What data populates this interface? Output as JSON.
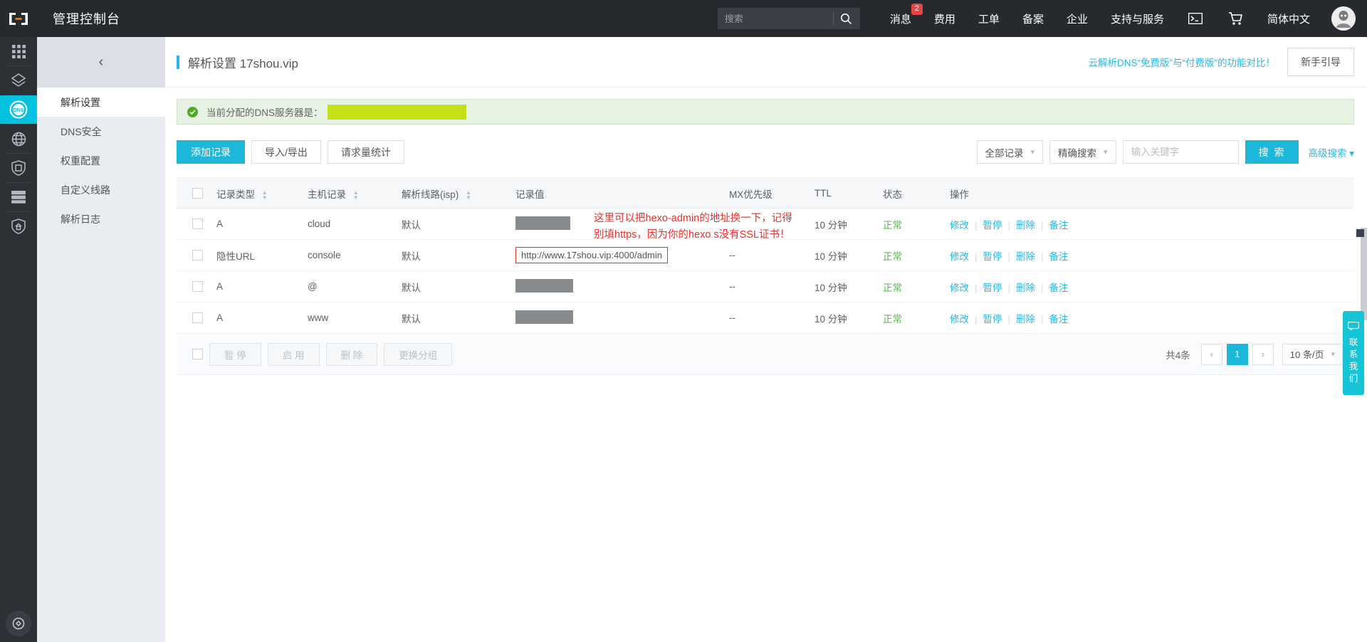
{
  "topbar": {
    "logo_name": "aliyun-logo",
    "console_title": "管理控制台",
    "search_placeholder": "搜索",
    "nav": [
      {
        "label": "消息",
        "badge": "2"
      },
      {
        "label": "费用",
        "badge": ""
      },
      {
        "label": "工单",
        "badge": ""
      },
      {
        "label": "备案",
        "badge": ""
      },
      {
        "label": "企业",
        "badge": ""
      },
      {
        "label": "支持与服务",
        "badge": ""
      }
    ],
    "terminal_icon": "terminal-icon",
    "cart_icon": "shopping-cart-icon",
    "language": "简体中文",
    "avatar_icon": "user-avatar"
  },
  "rail": {
    "items": [
      {
        "name": "apps-grid-icon"
      },
      {
        "name": "ecs-cube-icon"
      },
      {
        "name": "dns-icon",
        "active": true
      },
      {
        "name": "globe-icon"
      },
      {
        "name": "shield-icon"
      },
      {
        "name": "server-stack-icon"
      },
      {
        "name": "security-home-icon"
      }
    ]
  },
  "sidebar": {
    "collapse_icon": "chevron-left-icon",
    "items": [
      {
        "label": "解析设置",
        "active": true
      },
      {
        "label": "DNS安全",
        "active": false
      },
      {
        "label": "权重配置",
        "active": false
      },
      {
        "label": "自定义线路",
        "active": false
      },
      {
        "label": "解析日志",
        "active": false
      }
    ]
  },
  "page": {
    "title": "解析设置 17shou.vip",
    "head_link": "云解析DNS“免费版”与“付费版”的功能对比！",
    "guide_button": "新手引导"
  },
  "notice": {
    "icon": "check-circle-icon",
    "text": "当前分配的DNS服务器是：",
    "redacted_color": "#c3e116"
  },
  "toolbar": {
    "add_record": "添加记录",
    "import_export": "导入/导出",
    "request_stats": "请求量统计",
    "filter_type": "全部记录",
    "filter_mode": "精确搜索",
    "keyword_placeholder": "输入关键字",
    "search_button": "搜 索",
    "advanced_search": "高级搜索",
    "chevron_icon": "chevron-down-icon"
  },
  "table": {
    "columns": [
      {
        "label": "记录类型",
        "sortable": true
      },
      {
        "label": "主机记录",
        "sortable": true
      },
      {
        "label": "解析线路(isp)",
        "sortable": true
      },
      {
        "label": "记录值",
        "sortable": false
      },
      {
        "label": "MX优先级",
        "sortable": false
      },
      {
        "label": "TTL",
        "sortable": false
      },
      {
        "label": "状态",
        "sortable": false
      },
      {
        "label": "操作",
        "sortable": false
      }
    ],
    "rows": [
      {
        "type": "A",
        "host": "cloud",
        "line": "默认",
        "value": "",
        "value_redacted": true,
        "redact_width": 77,
        "mx": "",
        "ttl": "10 分钟",
        "status": "正常"
      },
      {
        "type": "隐性URL",
        "host": "console",
        "line": "默认",
        "value": "http://www.17shou.vip:4000/admin",
        "value_redacted": false,
        "redact_width": 0,
        "mx": "--",
        "ttl": "10 分钟",
        "status": "正常"
      },
      {
        "type": "A",
        "host": "@",
        "line": "默认",
        "value": "",
        "value_redacted": true,
        "redact_width": 81,
        "mx": "--",
        "ttl": "10 分钟",
        "status": "正常"
      },
      {
        "type": "A",
        "host": "www",
        "line": "默认",
        "value": "",
        "value_redacted": true,
        "redact_width": 81,
        "mx": "--",
        "ttl": "10 分钟",
        "status": "正常"
      }
    ],
    "row_actions": [
      "修改",
      "暂停",
      "删除",
      "备注"
    ]
  },
  "annotation": {
    "line1": "这里可以把hexo-admin的地址换一下，记得",
    "line2": "别填https，因为你的hexo s没有SSL证书！",
    "color": "#e8332a"
  },
  "footer": {
    "buttons": [
      "暂 停",
      "启 用",
      "删 除",
      "更换分组"
    ],
    "total": "共4条",
    "prev_icon": "chevron-left-icon",
    "next_icon": "chevron-right-icon",
    "current_page": "1",
    "page_size": "10 条/页"
  },
  "contact_widget": {
    "icon": "chat-bubble-icon",
    "chars": [
      "联",
      "系",
      "我",
      "们"
    ]
  }
}
